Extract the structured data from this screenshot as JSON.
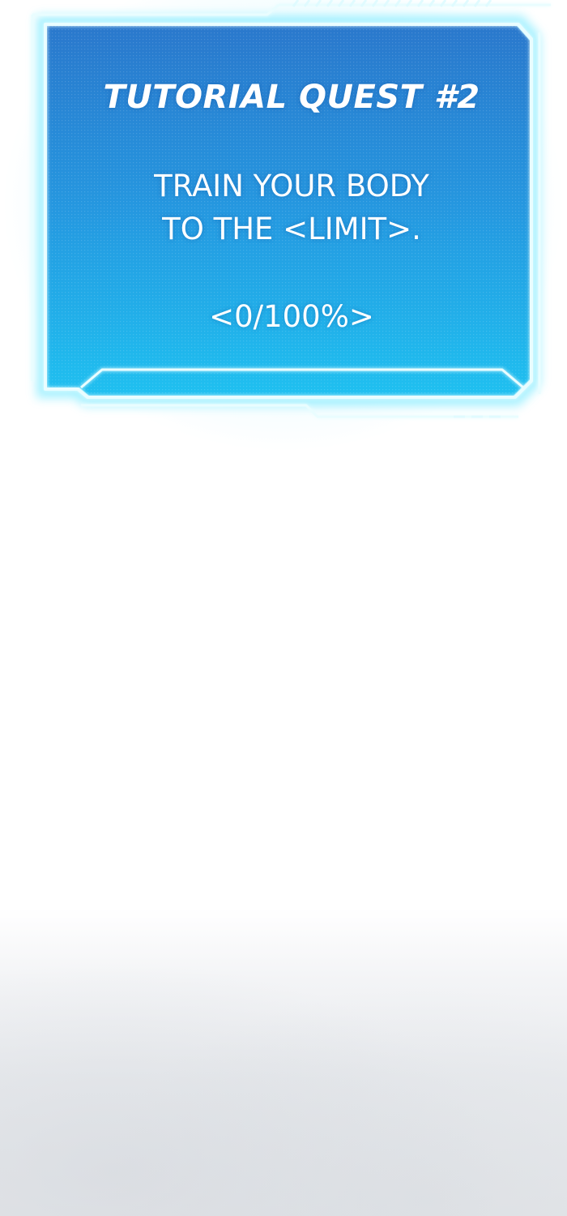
{
  "quest": {
    "title": "TUTORIAL QUEST #2",
    "description_line1": "TRAIN YOUR BODY",
    "description_line2": "TO THE <LIMIT>.",
    "progress_text": "<0/100%>",
    "progress_value": 0,
    "progress_max": 100
  },
  "colors": {
    "panel_top": "#2b7fd0",
    "panel_bottom": "#1fb6ec",
    "frame_glow": "#5fe6ff",
    "frame_line": "#e6fdff",
    "text": "#ffffff",
    "background": "#ffffff"
  }
}
